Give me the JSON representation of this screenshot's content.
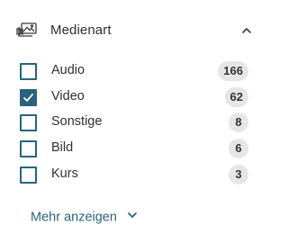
{
  "filter": {
    "title": "Medienart",
    "header_icon": "media-type-icon",
    "collapse_icon": "chevron-up-icon",
    "accent_color": "#28637f",
    "options": [
      {
        "label": "Audio",
        "count": "166",
        "checked": false
      },
      {
        "label": "Video",
        "count": "62",
        "checked": true
      },
      {
        "label": "Sonstige",
        "count": "8",
        "checked": false
      },
      {
        "label": "Bild",
        "count": "6",
        "checked": false
      },
      {
        "label": "Kurs",
        "count": "3",
        "checked": false
      }
    ],
    "more_label": "Mehr anzeigen",
    "more_icon": "chevron-down-icon"
  }
}
